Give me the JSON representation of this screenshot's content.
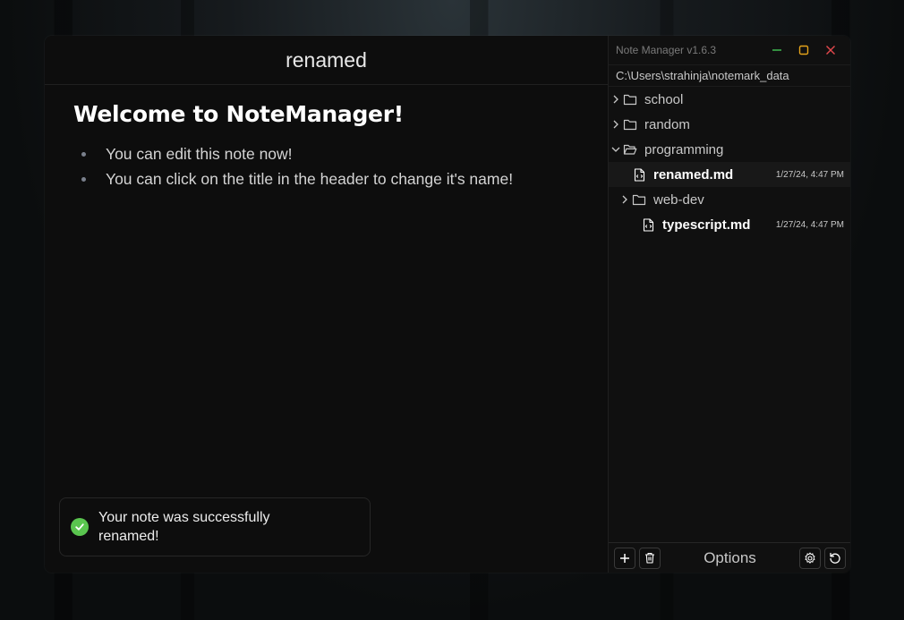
{
  "app": {
    "title": "Note Manager v1.6.3"
  },
  "colors": {
    "success": "#5ac54f",
    "minimize": "#3fb950",
    "maximize": "#e3a21a",
    "close": "#e5484d"
  },
  "editor": {
    "note_title": "renamed",
    "heading": "Welcome to NoteManager!",
    "bullets": [
      "You can edit this note now!",
      "You can click on the title in the header to change it's name!"
    ]
  },
  "toast": {
    "message": "Your note was successfully renamed!",
    "icon": "check-circle-icon"
  },
  "sidebar": {
    "path": "C:\\Users\\strahinja\\notemark_data",
    "tree": [
      {
        "type": "folder",
        "name": "school",
        "expanded": false
      },
      {
        "type": "folder",
        "name": "random",
        "expanded": false
      },
      {
        "type": "folder",
        "name": "programming",
        "expanded": true
      },
      {
        "type": "file",
        "name": "renamed.md",
        "date": "1/27/24, 4:47 PM",
        "selected": true
      },
      {
        "type": "folder",
        "name": "web-dev",
        "expanded": false
      },
      {
        "type": "file",
        "name": "typescript.md",
        "date": "1/27/24, 4:47 PM",
        "selected": false
      }
    ],
    "footer": {
      "options_label": "Options"
    }
  }
}
